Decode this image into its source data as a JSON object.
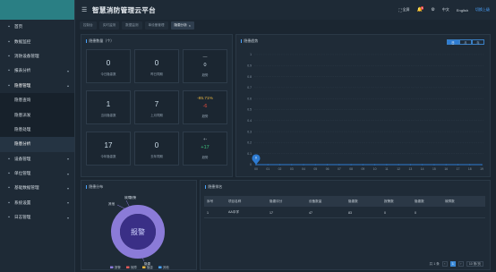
{
  "header": {
    "app_title": "智慧消防管理云平台",
    "menu_icon": "menu-icon",
    "fullscreen_label": "全屏",
    "notification_count": "6",
    "lang_cn": "中文",
    "lang_en": "English",
    "user_label": "切换上级"
  },
  "tabs": [
    {
      "label": "控制台"
    },
    {
      "label": "实时监测"
    },
    {
      "label": "数据监测"
    },
    {
      "label": "单设备管理"
    },
    {
      "label": "隐患分析",
      "active": true
    }
  ],
  "sidebar": {
    "items": [
      {
        "label": "首页",
        "icon": "home-icon"
      },
      {
        "label": "数据监控",
        "icon": "monitor-icon"
      },
      {
        "label": "消防设备管理",
        "icon": "device-icon"
      },
      {
        "label": "报表分析",
        "icon": "chart-icon"
      },
      {
        "label": "隐患管理",
        "icon": "warning-icon"
      },
      {
        "label": "隐患查询",
        "sub": true
      },
      {
        "label": "隐患派发",
        "sub": true
      },
      {
        "label": "隐患处理",
        "sub": true
      },
      {
        "label": "隐患分析",
        "sub": true,
        "active": true
      },
      {
        "label": "设备管理",
        "icon": "settings-icon"
      },
      {
        "label": "单位管理",
        "icon": "building-icon"
      },
      {
        "label": "基础数据管理",
        "icon": "database-icon"
      },
      {
        "label": "系统设置",
        "icon": "gear-icon"
      },
      {
        "label": "日志管理",
        "icon": "log-icon"
      }
    ]
  },
  "stats_panel": {
    "title": "隐患数量（个）",
    "cells": [
      {
        "value": "0",
        "label": "今日隐患数"
      },
      {
        "value": "0",
        "label": "昨日同期"
      },
      {
        "top": "—",
        "mid": "0",
        "bot": "趋势"
      },
      {
        "value": "1",
        "label": "当月隐患数"
      },
      {
        "value": "7",
        "label": "上月同期"
      },
      {
        "top": "-85.71%",
        "mid": "-6",
        "bot": "趋势"
      },
      {
        "value": "17",
        "label": "今年隐患数"
      },
      {
        "value": "0",
        "label": "去年同期"
      },
      {
        "top": "+-",
        "mid": "+17",
        "bot": "趋势"
      }
    ]
  },
  "trend_panel": {
    "title": "隐患趋势",
    "toggle": [
      "日",
      "月",
      "年"
    ],
    "active_toggle": "日"
  },
  "chart_data": {
    "type": "line",
    "title": "",
    "x": [
      "00",
      "01",
      "02",
      "03",
      "04",
      "05",
      "06",
      "07",
      "08",
      "09",
      "10",
      "11",
      "12",
      "13",
      "14",
      "15",
      "16",
      "17",
      "18",
      "19"
    ],
    "y_ticks": [
      "0",
      "0.1",
      "0.2",
      "0.3",
      "0.4",
      "0.5",
      "0.6",
      "0.7",
      "0.8",
      "0.9",
      "1"
    ],
    "series": [
      {
        "values": [
          0,
          0,
          0,
          0,
          0,
          0,
          0,
          0,
          0,
          0,
          0,
          0,
          0,
          0,
          0,
          0,
          0,
          0,
          0,
          0
        ]
      }
    ],
    "ylim": [
      0,
      1
    ],
    "marker_label": "0",
    "colors": {
      "line": "#2d7bd2",
      "marker": "#2d7bd2"
    }
  },
  "dist_panel": {
    "title": "隐患分布",
    "center_label": "报警",
    "callouts": [
      "故障",
      "报警",
      "其他",
      "隐患"
    ],
    "legend": [
      "报警",
      "故障",
      "隐患",
      "其他"
    ],
    "donut_color": "#8b7bd8"
  },
  "rank_panel": {
    "title": "隐患排名",
    "columns": [
      "序号",
      "项目名称",
      "隐患评分",
      "设备数量",
      "隐患数",
      "报警数",
      "隐患数",
      "故障数"
    ],
    "rows": [
      [
        "1",
        "AA中学",
        "17",
        "47",
        "83",
        "0",
        "0",
        ""
      ]
    ],
    "pager": {
      "total": "共 1 条",
      "page": "1",
      "size": "10 条/页"
    }
  }
}
